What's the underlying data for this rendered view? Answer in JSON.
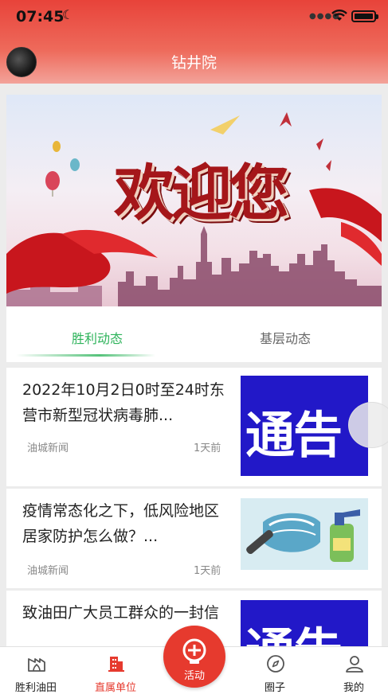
{
  "status": {
    "time": "07:45"
  },
  "header": {
    "title": "钻井院"
  },
  "banner": {
    "text": "欢迎您"
  },
  "tabs": [
    {
      "label": "胜利动态",
      "active": true
    },
    {
      "label": "基层动态",
      "active": false
    }
  ],
  "news": [
    {
      "title": "2022年10月2日0时至24时东营市新型冠状病毒肺...",
      "source": "油城新闻",
      "time": "1天前",
      "thumb_text": "通告"
    },
    {
      "title": "疫情常态化之下，低风险地区居家防护怎么做？...",
      "source": "油城新闻",
      "time": "1天前"
    },
    {
      "title": "致油田广大员工群众的一封信",
      "thumb_text": "通告"
    }
  ],
  "tabbar": [
    {
      "label": "胜利油田",
      "icon": "oilfield-icon"
    },
    {
      "label": "直属单位",
      "icon": "building-icon",
      "active": true
    },
    {
      "label": "活动",
      "icon": "activity-icon"
    },
    {
      "label": "圈子",
      "icon": "compass-icon"
    },
    {
      "label": "我的",
      "icon": "user-icon"
    }
  ],
  "colors": {
    "accent": "#e63a2e",
    "tab_active": "#2db35a",
    "notice_bg": "#2218c8"
  }
}
